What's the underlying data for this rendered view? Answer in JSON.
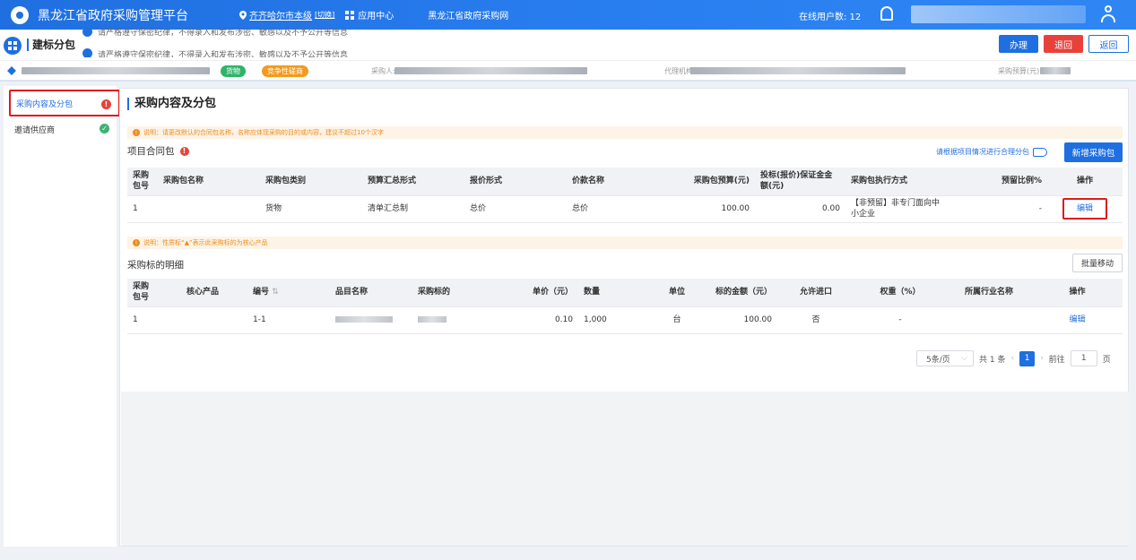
{
  "topbar": {
    "title": "黑龙江省政府采购管理平台",
    "region": "齐齐哈尔市本级",
    "region_tag": "[切换]",
    "apps": "应用中心",
    "site": "黑龙江省政府采购网",
    "online_label": "在线用户数: 12"
  },
  "subhead": {
    "page_title": "建标分包",
    "notice_1": "请严格遵守保密纪律，不得录入和发布涉密、敏感以及不予公开等信息",
    "notice_2": "请严格遵守保密纪律，不得录入和发布涉密、敏感以及不予公开等信息",
    "btn_handle": "办理",
    "btn_return": "退回",
    "btn_back": "返回"
  },
  "infobar": {
    "badge_goods": "货物",
    "badge_method": "竞争性磋商",
    "purchaser_label": "采购人:",
    "agency_label": "代理机构:",
    "budget_label": "采购预算(元):"
  },
  "leftnav": {
    "items": [
      {
        "label": "采购内容及分包",
        "status": "!"
      },
      {
        "label": "邀请供应商",
        "status": "✓"
      }
    ],
    "colors": {
      "active": "#1f6fe0",
      "warn": "#e8413b",
      "ok": "#3cb371"
    }
  },
  "main": {
    "heading": "采购内容及分包",
    "tip_1": "说明：请更改默认的合同包名称，名称应体现采购的目的或内容，建议不超过10个汉字",
    "contract_title": "项目合同包",
    "hint": "请根据项目情况进行合理分包",
    "add_btn": "新增采购包",
    "contract_table": {
      "headers": [
        "采购包号",
        "采购包名称",
        "采购包类别",
        "预算汇总形式",
        "报价形式",
        "价款名称",
        "采购包预算(元)",
        "投标(报价)保证金金额(元)",
        "采购包执行方式",
        "预留比例%",
        "操作"
      ],
      "rows": [
        {
          "no": "1",
          "name": "",
          "category": "货物",
          "summary": "清单汇总制",
          "quote": "总价",
          "price_name": "总价",
          "budget": "100.00",
          "deposit": "0.00",
          "mode": "【非预留】非专门面向中小企业",
          "ratio": "-",
          "action": "编辑"
        }
      ]
    },
    "tip_2": "说明：性质标“▲”表示此采购标的为核心产品",
    "detail_title": "采购标的明细",
    "batch_btn": "批量移动",
    "detail_table": {
      "headers": [
        "采购包号",
        "核心产品",
        "编号",
        "品目名称",
        "采购标的",
        "单价（元）",
        "数量",
        "单位",
        "标的金额（元）",
        "允许进口",
        "权重（%）",
        "所属行业名称",
        "操作"
      ],
      "sort_icon": "⇅",
      "rows": [
        {
          "no": "1",
          "core": "",
          "code": "1-1",
          "unit_price": "0.10",
          "qty": "1,000",
          "unit": "台",
          "amount": "100.00",
          "import": "否",
          "weight": "-",
          "industry": "",
          "action": "编辑"
        }
      ]
    },
    "pager": {
      "size": "5条/页",
      "total": "共 1 条",
      "current": "1",
      "goto_label": "前往",
      "goto_value": "1",
      "page_suffix": "页"
    }
  }
}
